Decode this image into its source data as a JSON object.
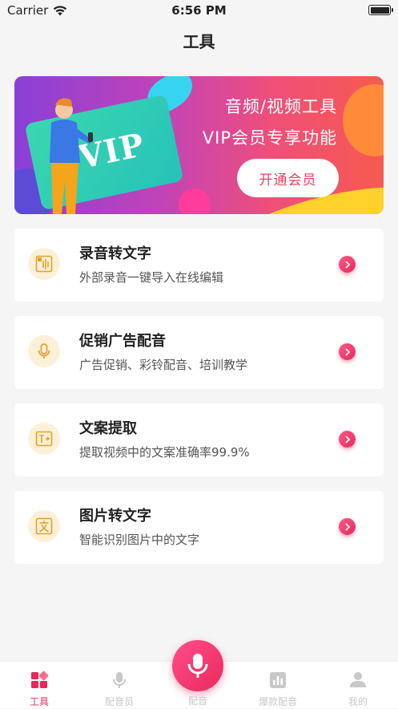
{
  "status_bar": {
    "carrier": "Carrier",
    "time": "6:56 PM"
  },
  "nav": {
    "title": "工具"
  },
  "banner": {
    "line1": "音频/视频工具",
    "line2": "VIP会员专享功能",
    "card_text": "VIP",
    "button": "开通会员"
  },
  "tools": [
    {
      "title": "录音转文字",
      "desc": "外部录音一键导入在线编辑",
      "icon": "audio-to-text-icon"
    },
    {
      "title": "促销广告配音",
      "desc": "广告促销、彩铃配音、培训教学",
      "icon": "microphone-icon"
    },
    {
      "title": "文案提取",
      "desc": "提取视频中的文案准确率99.9%",
      "icon": "text-extract-icon"
    },
    {
      "title": "图片转文字",
      "desc": "智能识别图片中的文字",
      "icon": "image-to-text-icon"
    }
  ],
  "tabbar": {
    "items": [
      {
        "label": "工具",
        "active": true
      },
      {
        "label": "配音员",
        "active": false
      },
      {
        "label": "配音",
        "active": false
      },
      {
        "label": "爆款配音",
        "active": false
      },
      {
        "label": "我的",
        "active": false
      }
    ]
  },
  "colors": {
    "accent": "#e8285a",
    "icon_bg": "#fdf0d8",
    "icon_stroke": "#e3a22c",
    "inactive_tab": "#c8c8c8"
  }
}
